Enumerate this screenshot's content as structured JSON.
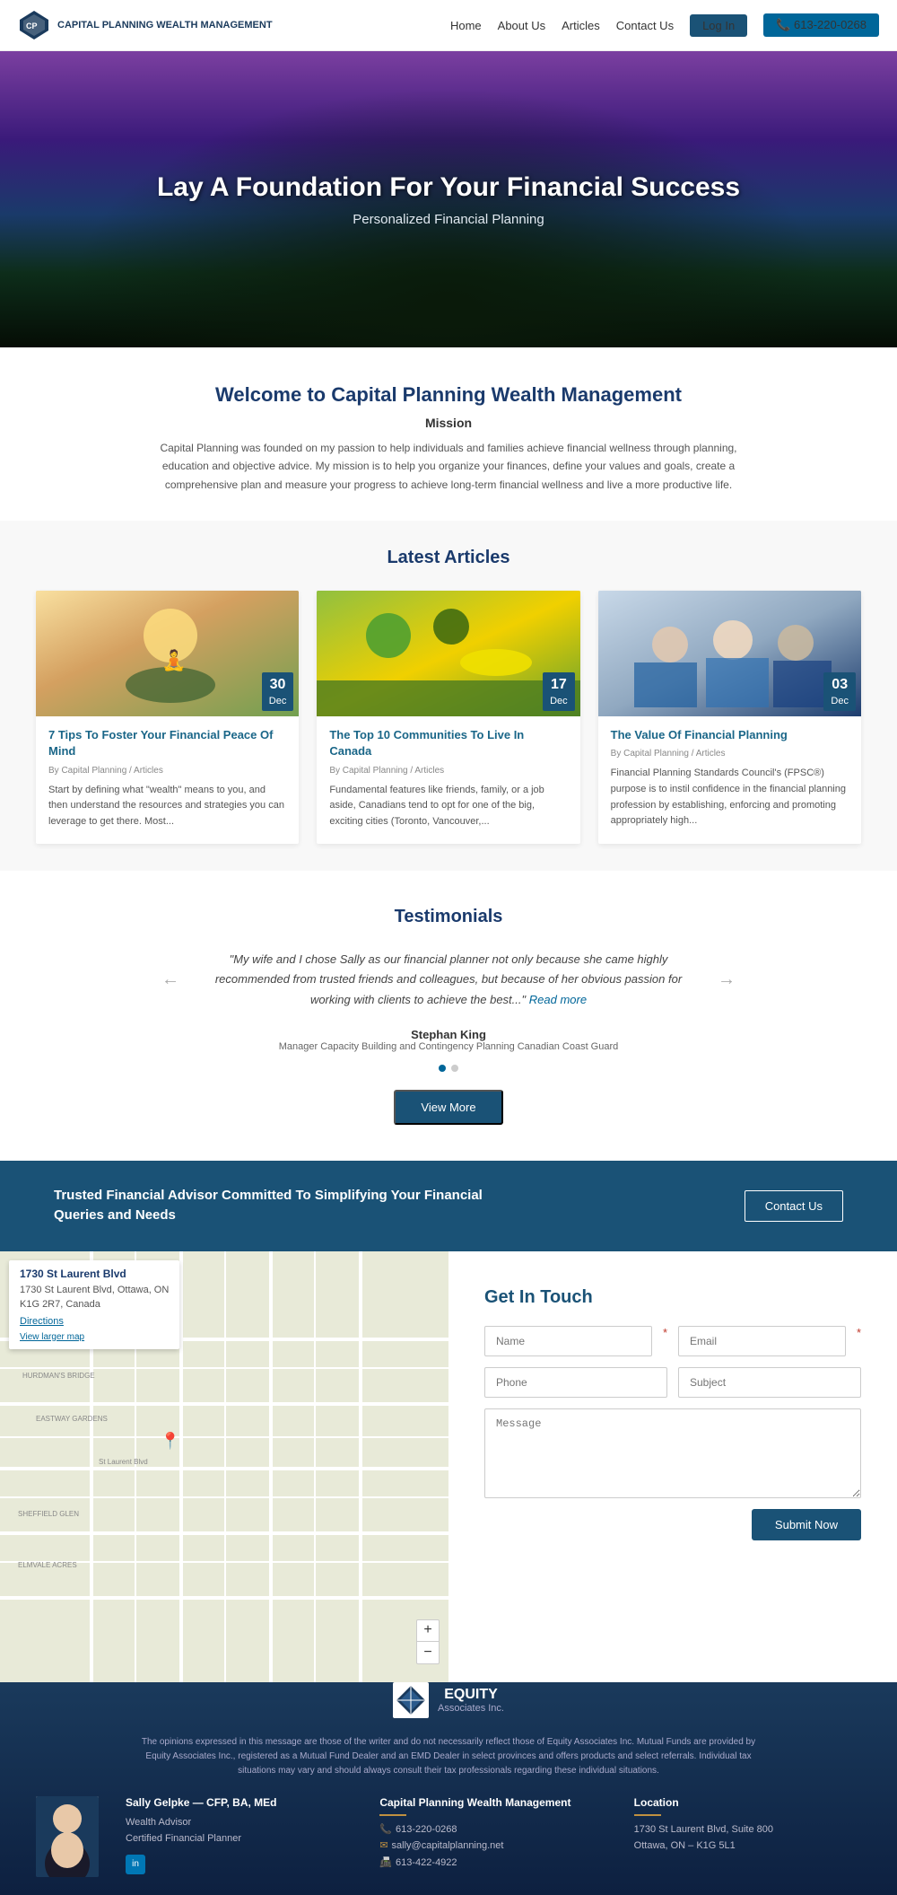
{
  "nav": {
    "logo_text": "CAPITAL PLANNING\nWEALTH MANAGEMENT",
    "links": [
      "Home",
      "About Us",
      "Articles",
      "Contact Us"
    ],
    "login_label": "Log In",
    "phone_label": "📞 613-220-0268"
  },
  "hero": {
    "title": "Lay A Foundation For Your Financial Success",
    "subtitle": "Personalized Financial Planning"
  },
  "welcome": {
    "title": "Welcome to Capital Planning Wealth Management",
    "mission_heading": "Mission",
    "body": "Capital Planning was founded on my passion to help individuals and families achieve financial wellness through planning, education and objective advice. My mission is to help you organize your finances, define your values and goals, create a comprehensive plan and measure your progress to achieve long-term financial wellness and live a more productive life."
  },
  "articles": {
    "section_title": "Latest Articles",
    "items": [
      {
        "date_day": "30",
        "date_month": "Dec",
        "title": "7 Tips To Foster Your Financial Peace Of Mind",
        "meta": "By Capital Planning / Articles",
        "excerpt": "Start by defining what \"wealth\" means to you, and then understand the resources and strategies you can leverage to get there. Most..."
      },
      {
        "date_day": "17",
        "date_month": "Dec",
        "title": "The Top 10 Communities To Live In Canada",
        "meta": "By Capital Planning / Articles",
        "excerpt": "Fundamental features like friends, family, or a job aside, Canadians tend to opt for one of the big, exciting cities (Toronto, Vancouver,..."
      },
      {
        "date_day": "03",
        "date_month": "Dec",
        "title": "The Value Of Financial Planning",
        "meta": "By Capital Planning / Articles",
        "excerpt": "Financial Planning Standards Council's (FPSC®) purpose is to instil confidence in the financial planning profession by establishing, enforcing and promoting appropriately high..."
      }
    ]
  },
  "testimonials": {
    "section_title": "Testimonials",
    "quote": "\"My wife and I chose Sally as our financial planner not only because she came highly recommended from trusted friends and colleagues, but because of her obvious passion for working with clients to achieve the best...\"",
    "read_more_label": "Read more",
    "author_name": "Stephan King",
    "author_role": "Manager Capacity Building and Contingency Planning Canadian Coast Guard",
    "view_more_label": "View More"
  },
  "cta": {
    "text": "Trusted Financial Advisor Committed To Simplifying Your Financial Queries and Needs",
    "button_label": "Contact Us"
  },
  "map": {
    "address_title": "1730 St Laurent Blvd",
    "address_line1": "1730 St Laurent Blvd, Ottawa, ON",
    "address_line2": "K1G 2R7, Canada",
    "directions_label": "Directions",
    "view_larger_label": "View larger map"
  },
  "contact": {
    "title": "Get In Touch",
    "name_placeholder": "Name",
    "email_placeholder": "Email",
    "phone_placeholder": "Phone",
    "subject_placeholder": "Subject",
    "message_placeholder": "Message",
    "submit_label": "Submit Now"
  },
  "footer": {
    "equity_name": "EQUITY",
    "equity_inc": "Associates Inc.",
    "disclaimer": "The opinions expressed in this message are those of the writer and do not necessarily reflect those of Equity Associates Inc. Mutual Funds are provided by Equity Associates Inc., registered as a Mutual Fund Dealer and an EMD Dealer in select provinces and offers products and select referrals. Individual tax situations may vary and should always consult their tax professionals regarding these individual situations.",
    "col1_title": "Sally Gelpke — CFP, BA, MEd",
    "col1_sub1": "Wealth Advisor",
    "col1_sub2": "Certified Financial Planner",
    "col2_title": "Capital Planning Wealth Management",
    "col2_divider": true,
    "col2_phone": "613-220-0268",
    "col2_email": "sally@capitalplanning.net",
    "col2_fax": "613-422-4922",
    "col3_title": "Location",
    "col3_divider": true,
    "col3_address": "1730 St Laurent Blvd, Suite 800\nOttawa, ON – K1G 5L1"
  }
}
